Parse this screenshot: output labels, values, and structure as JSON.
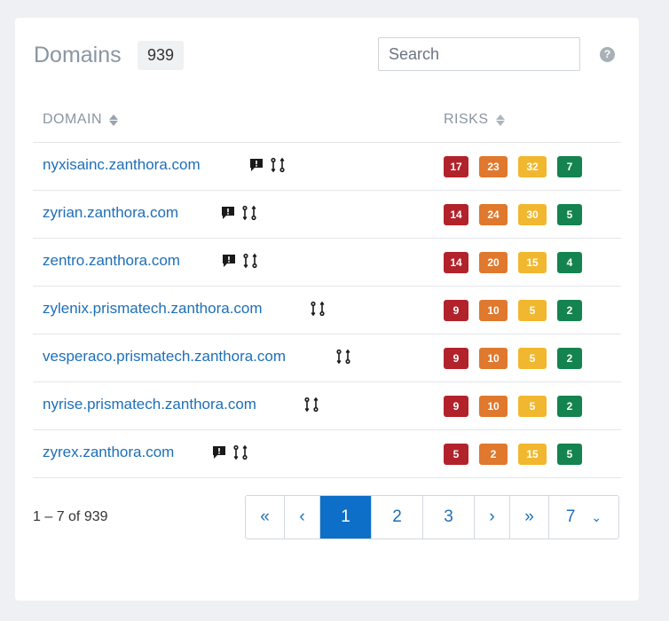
{
  "header": {
    "title": "Domains",
    "count": "939",
    "search_placeholder": "Search",
    "help_icon": "?"
  },
  "columns": {
    "domain": "DOMAIN",
    "risks": "RISKS"
  },
  "rows": [
    {
      "domain": "nyxisainc.zanthora.com",
      "has_comment": true,
      "has_diff": true,
      "risks": [
        "17",
        "23",
        "32",
        "7"
      ]
    },
    {
      "domain": "zyrian.zanthora.com",
      "has_comment": true,
      "has_diff": true,
      "risks": [
        "14",
        "24",
        "30",
        "5"
      ]
    },
    {
      "domain": "zentro.zanthora.com",
      "has_comment": true,
      "has_diff": true,
      "risks": [
        "14",
        "20",
        "15",
        "4"
      ]
    },
    {
      "domain": "zylenix.prismatech.zanthora.com",
      "has_comment": false,
      "has_diff": true,
      "risks": [
        "9",
        "10",
        "5",
        "2"
      ]
    },
    {
      "domain": "vesperaco.prismatech.zanthora.com",
      "has_comment": false,
      "has_diff": true,
      "risks": [
        "9",
        "10",
        "5",
        "2"
      ]
    },
    {
      "domain": "nyrise.prismatech.zanthora.com",
      "has_comment": false,
      "has_diff": true,
      "risks": [
        "9",
        "10",
        "5",
        "2"
      ]
    },
    {
      "domain": "zyrex.zanthora.com",
      "has_comment": true,
      "has_diff": true,
      "risks": [
        "5",
        "2",
        "15",
        "5"
      ]
    }
  ],
  "footer": {
    "range": "1 – 7 of 939",
    "pagination": {
      "first": "«",
      "prev": "‹",
      "pages": [
        "1",
        "2",
        "3"
      ],
      "next": "›",
      "last": "»",
      "page_select": "7"
    }
  },
  "colors": {
    "critical": "#b2222b",
    "high": "#e0782d",
    "medium": "#f1b72e",
    "low": "#14834f",
    "link": "#1d6fb8",
    "active_page": "#0d6fc7"
  },
  "icons": {
    "comment": "comment-alert-icon",
    "diff": "git-compare-icon",
    "sort": "sort-icon",
    "help": "help-icon",
    "chevron": "chevron-down-icon"
  }
}
